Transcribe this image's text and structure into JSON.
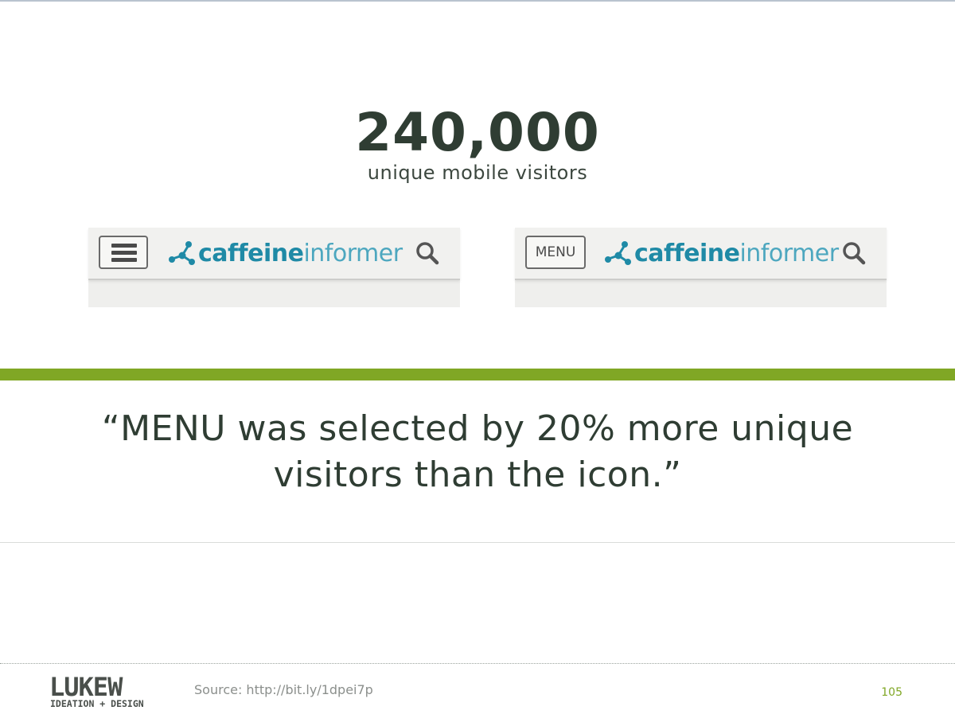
{
  "stat": {
    "number": "240,000",
    "caption": "unique mobile visitors"
  },
  "mockups": {
    "left": {
      "button_type": "hamburger",
      "logo_part1": "caffeine",
      "logo_part2": "informer"
    },
    "right": {
      "button_label": "MENU",
      "logo_part1": "caffeine",
      "logo_part2": "informer"
    }
  },
  "quote": {
    "line1": "“MENU was selected by 20% more unique",
    "line2": "visitors than the icon.”"
  },
  "footer": {
    "logo_text": "LUKEW",
    "logo_tagline": "IDEATION + DESIGN",
    "source": "Source: http://bit.ly/1dpei7p",
    "page_number": "105"
  },
  "colors": {
    "accent_green": "#80a725",
    "text_dark": "#2f3d33",
    "logo_blue": "#1f8aa6"
  }
}
